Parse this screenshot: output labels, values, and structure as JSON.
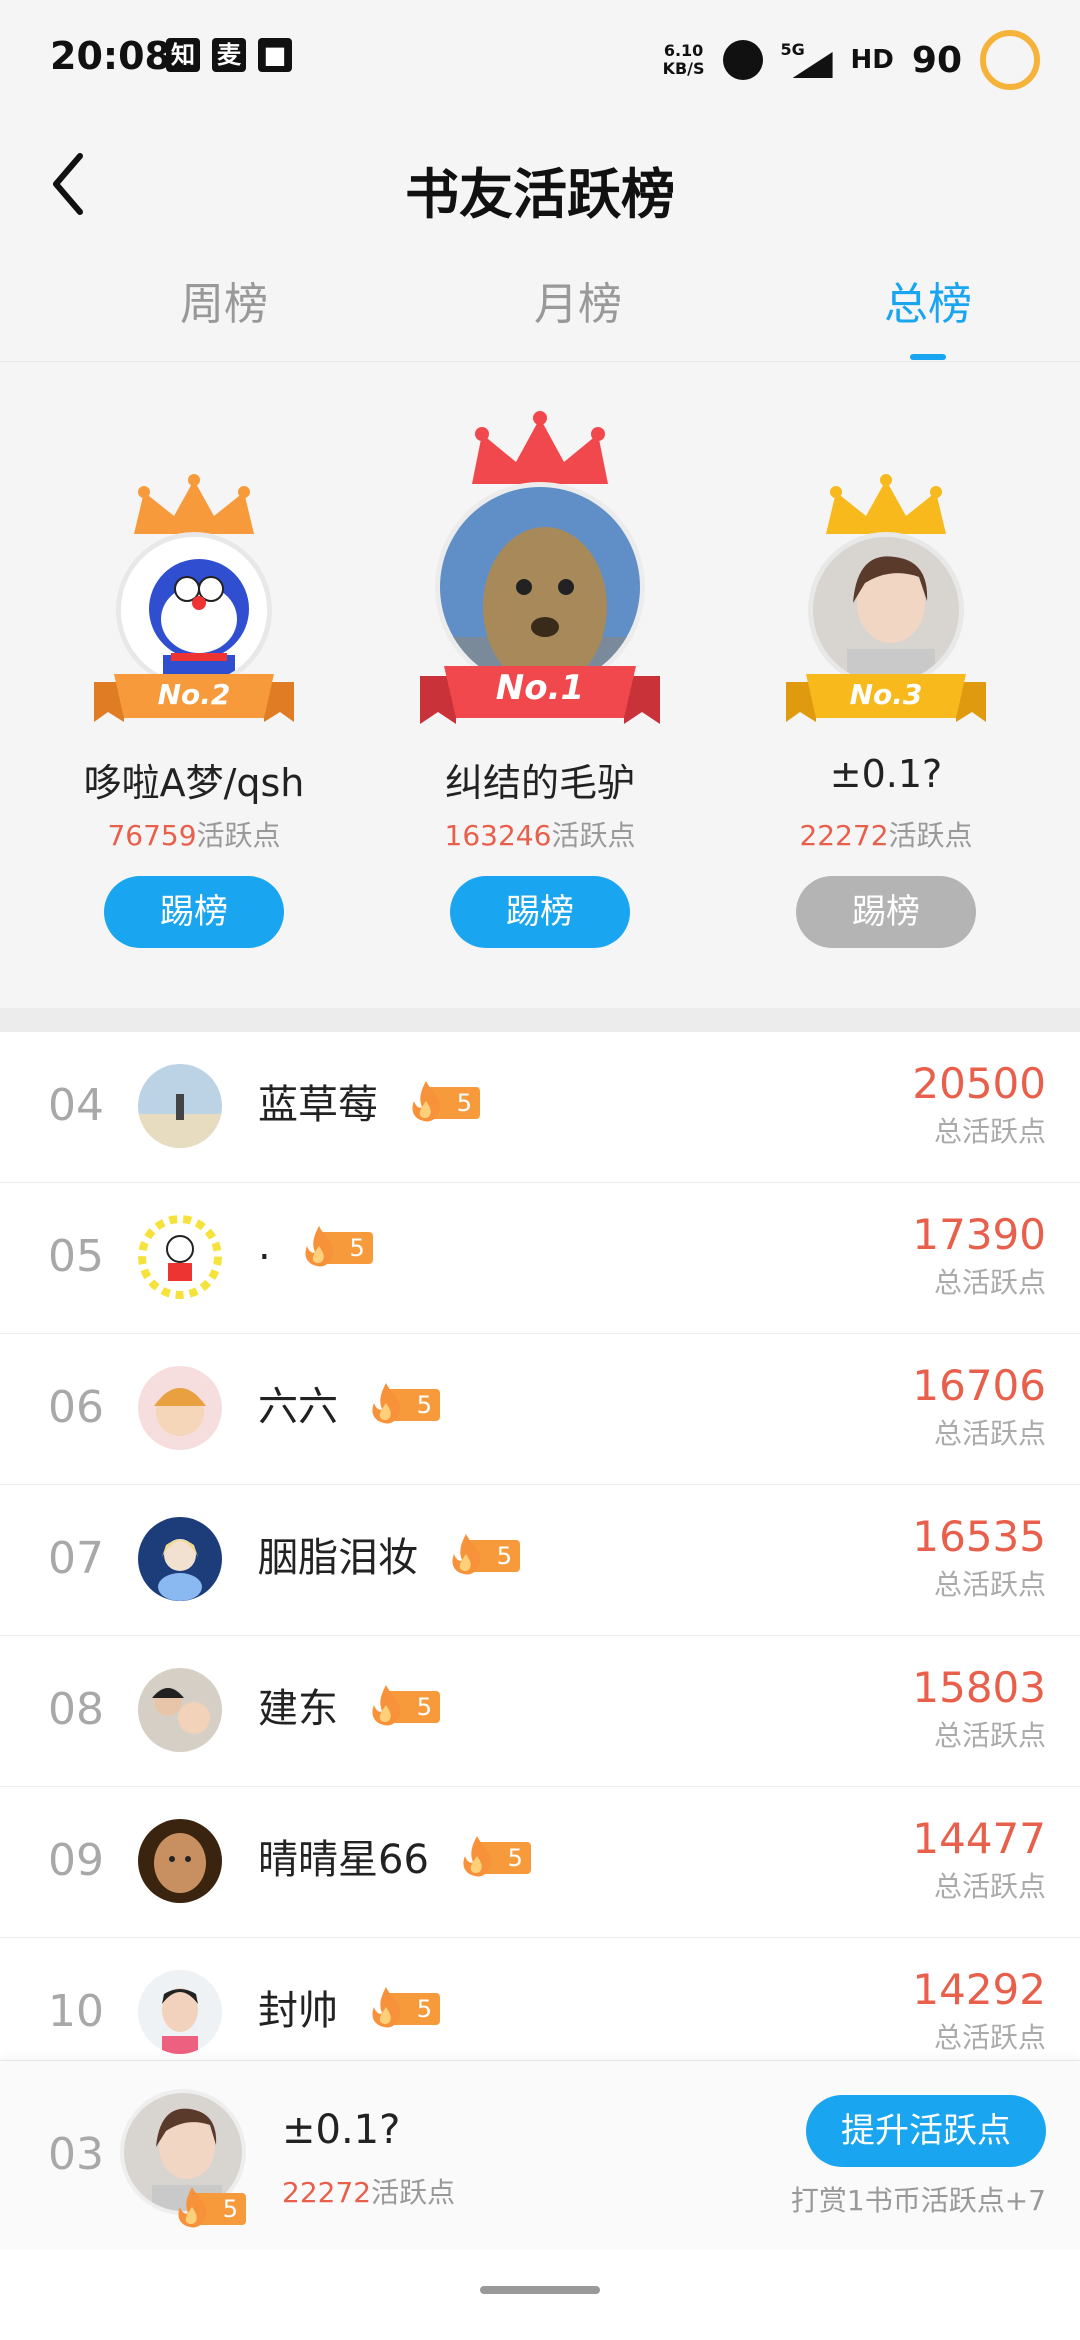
{
  "status_bar": {
    "time": "20:08",
    "app_icons": [
      "知",
      "麦",
      "■"
    ],
    "net_speed_value": "6.10",
    "net_speed_unit": "KB/S",
    "network": "5G",
    "hd": "HD",
    "battery": "90"
  },
  "header": {
    "title": "书友活跃榜"
  },
  "tabs": [
    {
      "label": "周榜",
      "active": false
    },
    {
      "label": "月榜",
      "active": false
    },
    {
      "label": "总榜",
      "active": true
    }
  ],
  "podium": [
    {
      "place": "No.2",
      "name": "哆啦A梦/qsh",
      "points": "76759",
      "points_unit": "活跃点",
      "button": "踢榜",
      "button_enabled": true,
      "crown_color": "#f79a3c"
    },
    {
      "place": "No.1",
      "name": "纠结的毛驴",
      "points": "163246",
      "points_unit": "活跃点",
      "button": "踢榜",
      "button_enabled": true,
      "crown_color": "#f0484c"
    },
    {
      "place": "No.3",
      "name": "±0.1?",
      "points": "22272",
      "points_unit": "活跃点",
      "button": "踢榜",
      "button_enabled": false,
      "crown_color": "#f7b91c"
    }
  ],
  "ranking": [
    {
      "rank": "04",
      "name": "蓝草莓",
      "level": "5",
      "points": "20500",
      "points_label": "总活跃点"
    },
    {
      "rank": "05",
      "name": ".",
      "level": "5",
      "points": "17390",
      "points_label": "总活跃点"
    },
    {
      "rank": "06",
      "name": "六六",
      "level": "5",
      "points": "16706",
      "points_label": "总活跃点"
    },
    {
      "rank": "07",
      "name": "胭脂泪妆",
      "level": "5",
      "points": "16535",
      "points_label": "总活跃点"
    },
    {
      "rank": "08",
      "name": "建东",
      "level": "5",
      "points": "15803",
      "points_label": "总活跃点"
    },
    {
      "rank": "09",
      "name": "晴晴星66",
      "level": "5",
      "points": "14477",
      "points_label": "总活跃点"
    },
    {
      "rank": "10",
      "name": "封帅",
      "level": "5",
      "points": "14292",
      "points_label": "总活跃点"
    }
  ],
  "my_rank": {
    "rank": "03",
    "name": "±0.1?",
    "level": "5",
    "points": "22272",
    "points_unit": "活跃点",
    "button": "提升活跃点",
    "tip": "打赏1书币活跃点+7"
  },
  "colors": {
    "accent": "#1aa5f0",
    "points": "#e8604c",
    "level": "#f79a3c"
  }
}
